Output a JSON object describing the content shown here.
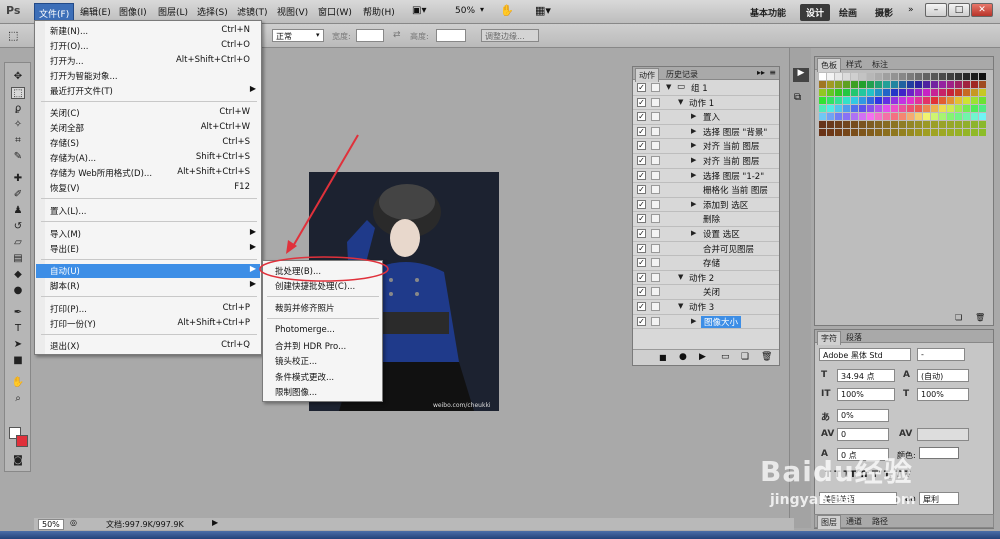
{
  "app": {
    "logo": "Ps"
  },
  "menubar": {
    "items": [
      "文件(F)",
      "编辑(E)",
      "图像(I)",
      "图层(L)",
      "选择(S)",
      "滤镜(T)",
      "视图(V)",
      "窗口(W)",
      "帮助(H)"
    ],
    "zoom": "50%",
    "workspaces": [
      "基本功能",
      "设计",
      "绘画",
      "摄影"
    ],
    "window_controls": [
      "–",
      "□",
      "✕"
    ]
  },
  "optbar": {
    "mode_value": "正常",
    "width_label": "宽度:",
    "height_label": "高度:",
    "refine_edge": "调整边缘..."
  },
  "file_menu": {
    "items": [
      {
        "label": "新建(N)...",
        "shortcut": "Ctrl+N"
      },
      {
        "label": "打开(O)...",
        "shortcut": "Ctrl+O"
      },
      {
        "label": "打开为...",
        "shortcut": "Alt+Shift+Ctrl+O"
      },
      {
        "label": "打开为智能对象...",
        "shortcut": ""
      },
      {
        "label": "最近打开文件(T)",
        "shortcut": "",
        "arrow": "▶"
      },
      {
        "label": "关闭(C)",
        "shortcut": "Ctrl+W"
      },
      {
        "label": "关闭全部",
        "shortcut": "Alt+Ctrl+W"
      },
      {
        "label": "存储(S)",
        "shortcut": "Ctrl+S"
      },
      {
        "label": "存储为(A)...",
        "shortcut": "Shift+Ctrl+S"
      },
      {
        "label": "存储为 Web所用格式(D)...",
        "shortcut": "Alt+Shift+Ctrl+S"
      },
      {
        "label": "恢复(V)",
        "shortcut": "F12"
      },
      {
        "label": "置入(L)...",
        "shortcut": ""
      },
      {
        "label": "导入(M)",
        "shortcut": "",
        "arrow": "▶"
      },
      {
        "label": "导出(E)",
        "shortcut": "",
        "arrow": "▶"
      },
      {
        "label": "自动(U)",
        "shortcut": "",
        "arrow": "▶"
      },
      {
        "label": "脚本(R)",
        "shortcut": "",
        "arrow": "▶"
      },
      {
        "label": "打印(P)...",
        "shortcut": "Ctrl+P"
      },
      {
        "label": "打印一份(Y)",
        "shortcut": "Alt+Shift+Ctrl+P"
      },
      {
        "label": "退出(X)",
        "shortcut": "Ctrl+Q"
      }
    ]
  },
  "automate_menu": {
    "items": [
      "批处理(B)...",
      "创建快捷批处理(C)...",
      "裁剪并修齐照片",
      "Photomerge...",
      "合并到 HDR Pro...",
      "镜头校正...",
      "条件模式更改...",
      "限制图像..."
    ]
  },
  "canvas": {
    "watermark": "weibo.com/cheukki"
  },
  "actions_panel": {
    "tabs": [
      "动作",
      "历史记录"
    ],
    "rows": [
      {
        "label": "组 1",
        "level": 0
      },
      {
        "label": "动作 1",
        "level": 1
      },
      {
        "label": "置入",
        "level": 2
      },
      {
        "label": "选择 图层 \"背景\"",
        "level": 2
      },
      {
        "label": "对齐 当前 图层",
        "level": 2
      },
      {
        "label": "对齐 当前 图层",
        "level": 2
      },
      {
        "label": "选择 图层 \"1-2\"",
        "level": 2
      },
      {
        "label": "栅格化 当前 图层",
        "level": 2
      },
      {
        "label": "添加到 选区",
        "level": 2
      },
      {
        "label": "删除",
        "level": 2
      },
      {
        "label": "设置 选区",
        "level": 2
      },
      {
        "label": "合并可见图层",
        "level": 2
      },
      {
        "label": "存储",
        "level": 2
      },
      {
        "label": "动作 2",
        "level": 1
      },
      {
        "label": "关闭",
        "level": 2
      },
      {
        "label": "动作 3",
        "level": 1
      },
      {
        "label": "图像大小",
        "level": 2
      }
    ]
  },
  "swatches_panel": {
    "tabs": [
      "色板",
      "样式",
      "标注"
    ]
  },
  "character_panel": {
    "tabs": [
      "字符",
      "段落"
    ],
    "font_family": "Adobe 黑体 Std",
    "font_style": "-",
    "size": "34.94 点",
    "leading": "(自动)",
    "vscale": "100%",
    "hscale": "100%",
    "tsume": "0%",
    "kerning": "0",
    "baseline": "0 点",
    "color_label": "颜色:",
    "language": "美国英语",
    "aa_label": "aa",
    "antialias": "犀利"
  },
  "bottom_panel": {
    "tabs": [
      "图层",
      "通道",
      "路径"
    ]
  },
  "status": {
    "zoom": "50%",
    "doc": "文档:997.9K/997.9K"
  },
  "watermark": {
    "brand": "Baidu经验",
    "url": "jingyan.baidu.com"
  },
  "colors": {
    "highlight": "#3d8ee6",
    "annotation": "#e0313b"
  }
}
